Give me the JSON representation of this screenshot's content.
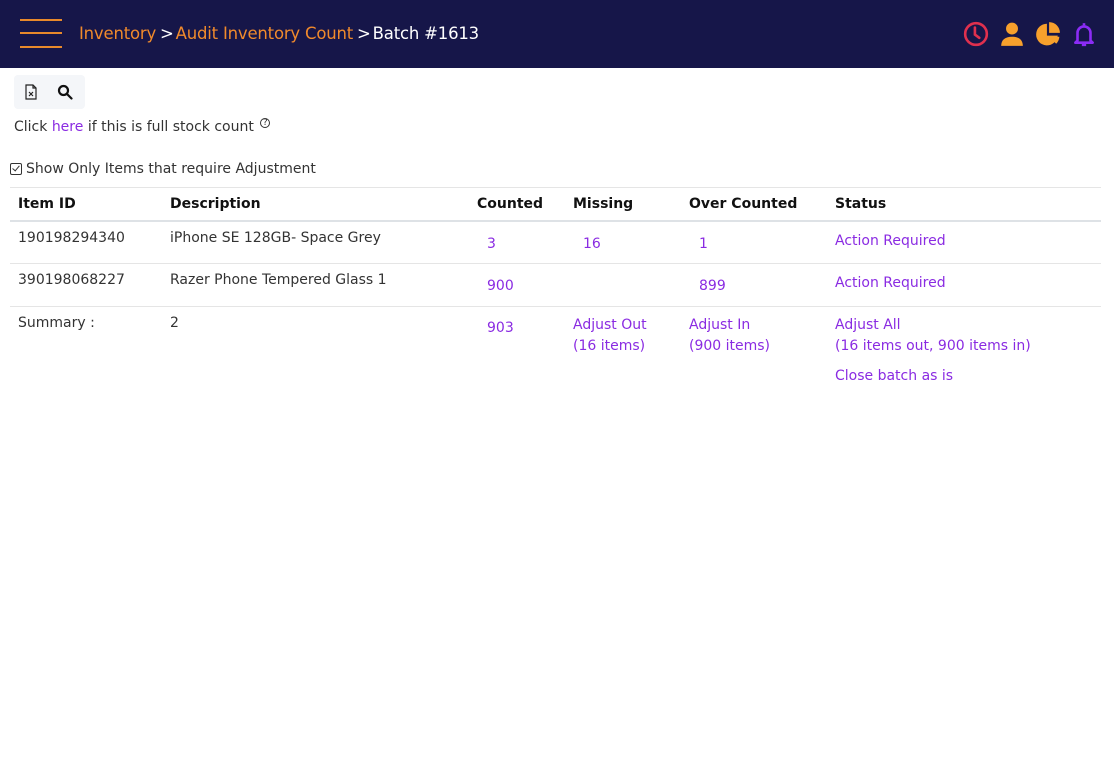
{
  "header": {
    "menu_icon": "hamburger-icon",
    "breadcrumb": [
      {
        "label": "Inventory",
        "link": true
      },
      {
        "label": "Audit Inventory Count",
        "link": true
      },
      {
        "label": "Batch #1613",
        "link": false
      }
    ],
    "separator": ">",
    "icons": [
      {
        "name": "clock-icon",
        "color": "#e0304e"
      },
      {
        "name": "user-icon",
        "color": "#f7a02c"
      },
      {
        "name": "pie-chart-icon",
        "color": "#f7a02c"
      },
      {
        "name": "bell-icon",
        "color": "#8b2cf5"
      }
    ],
    "background": "#161649",
    "accent": "#f08a2c"
  },
  "toolbar": {
    "export_excel_icon": "excel-file-icon",
    "search_icon": "search-icon"
  },
  "full_count": {
    "prefix": "Click",
    "link_label": "here",
    "suffix": "if this is full stock count",
    "help_icon": "question-icon"
  },
  "filter": {
    "label": "Show Only Items that require Adjustment",
    "checked": true
  },
  "table": {
    "headers": {
      "item_id": "Item ID",
      "description": "Description",
      "counted": "Counted",
      "missing": "Missing",
      "over_counted": "Over Counted",
      "status": "Status"
    },
    "rows": [
      {
        "item_id": "190198294340",
        "description": "iPhone SE 128GB- Space Grey",
        "counted": "3",
        "missing": "16",
        "over_counted": "1",
        "status": "Action Required"
      },
      {
        "item_id": "390198068227",
        "description": "Razer Phone Tempered Glass 1",
        "counted": "900",
        "missing": "",
        "over_counted": "899",
        "status": "Action Required"
      }
    ],
    "summary": {
      "label": "Summary :",
      "count": "2",
      "counted_total": "903",
      "adjust_out": "Adjust Out",
      "adjust_out_detail": "(16 items)",
      "adjust_in": "Adjust In",
      "adjust_in_detail": "(900 items)",
      "adjust_all": "Adjust All",
      "adjust_all_detail": "(16 items out, 900 items in)",
      "close_batch": "Close batch as is"
    }
  },
  "colors": {
    "link": "#8a2be2",
    "text": "#333333"
  }
}
